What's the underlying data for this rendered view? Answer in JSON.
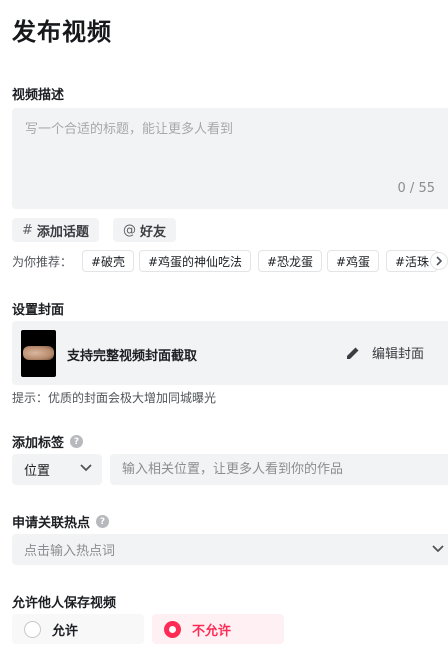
{
  "page": {
    "title": "发布视频"
  },
  "description": {
    "label": "视频描述",
    "placeholder": "写一个合适的标题，能让更多人看到",
    "counter": "0 / 55"
  },
  "chips": {
    "topic": {
      "symbol": "#",
      "label": "添加话题"
    },
    "friend": {
      "symbol": "@",
      "label": "好友"
    }
  },
  "recommend": {
    "label": "为你推荐：",
    "tags": [
      "#破壳",
      "#鸡蛋的神仙吃法",
      "#恐龙蛋",
      "#鸡蛋",
      "#活珠"
    ],
    "more_icon": "chevron-right-icon"
  },
  "cover": {
    "label": "设置封面",
    "text": "支持完整视频封面截取",
    "edit_label": "编辑封面",
    "edit_icon": "pencil-icon",
    "hint": "提示：优质的封面会极大增加同城曝光"
  },
  "tag": {
    "label": "添加标签",
    "help_icon": "?",
    "select_value": "位置",
    "input_placeholder": "输入相关位置，让更多人看到你的作品"
  },
  "hotspot": {
    "label": "申请关联热点",
    "help_icon": "?",
    "placeholder": "点击输入热点词"
  },
  "save": {
    "label": "允许他人保存视频",
    "options": [
      "允许",
      "不允许"
    ],
    "selected": "不允许"
  },
  "colors": {
    "accent": "#fe2c55",
    "field_bg": "#f2f3f4"
  }
}
